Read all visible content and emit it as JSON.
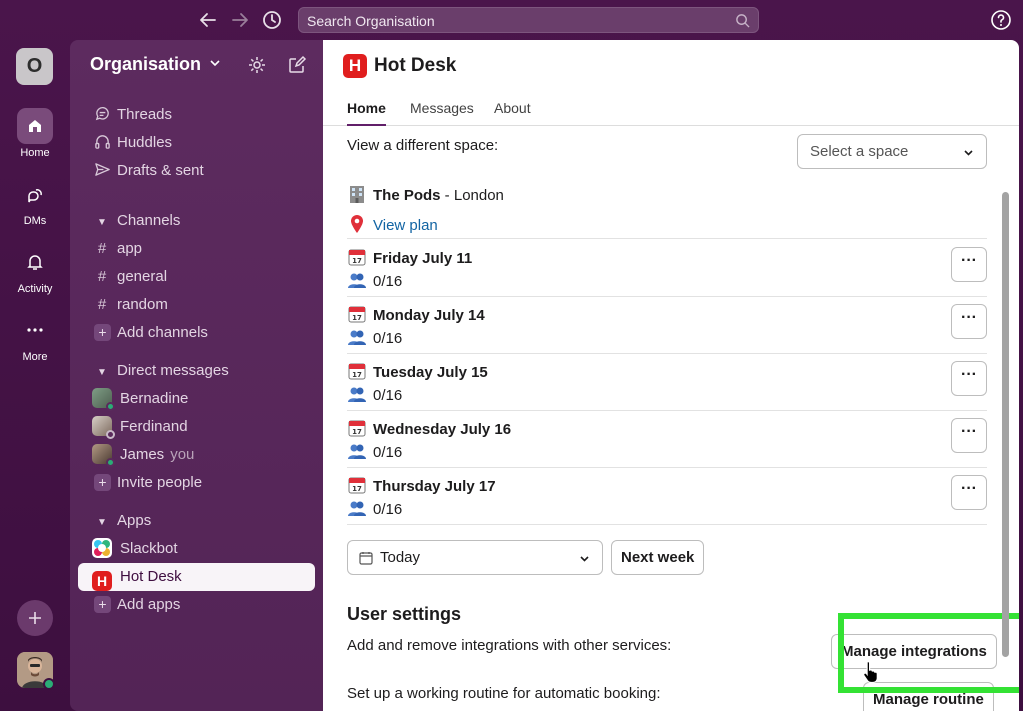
{
  "topbar": {
    "search_placeholder": "Search Organisation",
    "icons": [
      "arrow-left-icon",
      "arrow-right-icon",
      "history-icon",
      "search-icon",
      "help-icon"
    ]
  },
  "rail": {
    "workspace_initial": "O",
    "items": [
      {
        "label": "Home",
        "icon": "home-icon",
        "active": true
      },
      {
        "label": "DMs",
        "icon": "dms-icon"
      },
      {
        "label": "Activity",
        "icon": "bell-icon"
      },
      {
        "label": "More",
        "icon": "more-horizontal-icon"
      }
    ]
  },
  "sidebar": {
    "workspace_name": "Organisation",
    "top_items": [
      {
        "label": "Threads",
        "icon": "threads-icon"
      },
      {
        "label": "Huddles",
        "icon": "headphones-icon"
      },
      {
        "label": "Drafts & sent",
        "icon": "send-icon"
      }
    ],
    "channels_header": "Channels",
    "channels": [
      "app",
      "general",
      "random"
    ],
    "add_channels": "Add channels",
    "dm_header": "Direct messages",
    "dms": [
      {
        "name": "Bernadine"
      },
      {
        "name": "Ferdinand"
      },
      {
        "name": "James",
        "suffix": "you"
      }
    ],
    "invite_people": "Invite people",
    "apps_header": "Apps",
    "apps": [
      {
        "name": "Slackbot"
      },
      {
        "name": "Hot Desk",
        "active": true
      }
    ],
    "add_apps": "Add apps"
  },
  "main": {
    "app_logo_letter": "H",
    "app_title": "Hot Desk",
    "tabs": [
      "Home",
      "Messages",
      "About"
    ],
    "view_different_space": "View a different space:",
    "select_space_placeholder": "Select a space",
    "space_name": "The Pods",
    "space_location": " - London",
    "view_plan": "View plan",
    "days": [
      {
        "name": "Friday July 11",
        "count": "0/16"
      },
      {
        "name": "Monday July 14",
        "count": "0/16"
      },
      {
        "name": "Tuesday July 15",
        "count": "0/16"
      },
      {
        "name": "Wednesday July 16",
        "count": "0/16"
      },
      {
        "name": "Thursday July 17",
        "count": "0/16"
      }
    ],
    "more_label": "···",
    "date_picker_value": "Today",
    "next_week": "Next week",
    "user_settings_title": "User settings",
    "integrations_text": "Add and remove integrations with other services:",
    "manage_integrations": "Manage integrations",
    "routine_text": "Set up a working routine for automatic booking:",
    "manage_routine": "Manage routine"
  },
  "colors": {
    "aubergine": "#4a154b",
    "sidebar": "#5a2a5c",
    "highlight": "#34e234",
    "hotdesk_red": "#e01e1e",
    "link": "#1264a3"
  }
}
